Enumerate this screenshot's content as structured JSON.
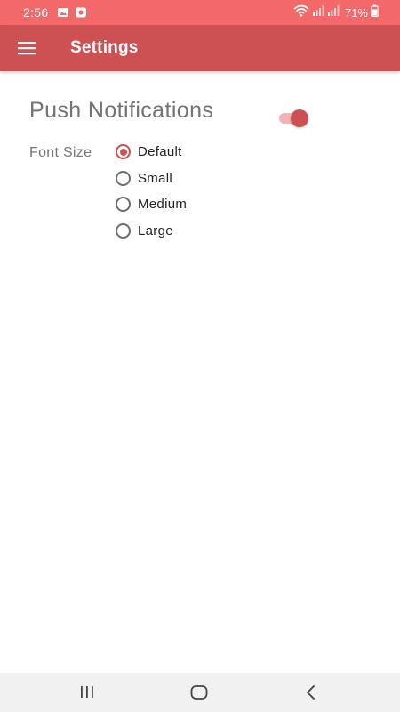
{
  "status_bar": {
    "time": "2:56",
    "battery_percent": "71%",
    "background_color": "#f36868"
  },
  "app_bar": {
    "title": "Settings",
    "background_color": "#cd5153",
    "menu_icon": "hamburger-menu-icon"
  },
  "settings": {
    "push_notifications": {
      "label": "Push Notifications",
      "enabled": true
    },
    "font_size": {
      "label": "Font Size",
      "selected": "Default",
      "options": [
        {
          "label": "Default",
          "selected": true
        },
        {
          "label": "Small",
          "selected": false
        },
        {
          "label": "Medium",
          "selected": false
        },
        {
          "label": "Large",
          "selected": false
        }
      ]
    }
  },
  "nav_bar": {
    "buttons": [
      "recent-apps-icon",
      "home-icon",
      "back-icon"
    ]
  },
  "accent_color": "#cd5153"
}
